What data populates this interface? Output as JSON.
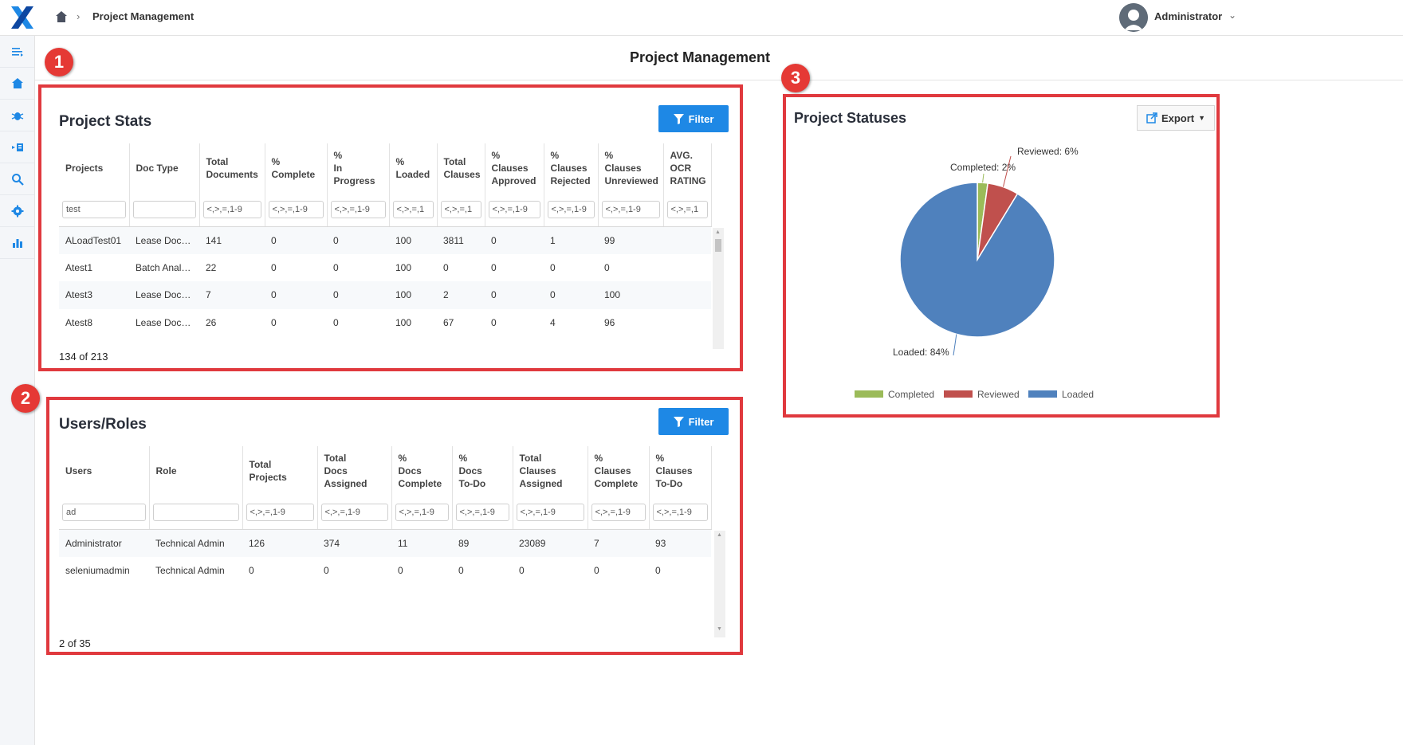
{
  "header": {
    "breadcrumb_title": "Project Management",
    "user_name": "Administrator"
  },
  "page": {
    "title": "Project Management"
  },
  "callouts": [
    "1",
    "2",
    "3"
  ],
  "project_stats": {
    "title": "Project Stats",
    "filter_label": "Filter",
    "columns": [
      [
        "Projects"
      ],
      [
        "Doc Type"
      ],
      [
        "Total",
        "Documents"
      ],
      [
        "%",
        "Complete"
      ],
      [
        "%",
        "In Progress"
      ],
      [
        "%",
        "Loaded"
      ],
      [
        "Total",
        "Clauses"
      ],
      [
        "%",
        "Clauses",
        "Approved"
      ],
      [
        "%",
        "Clauses",
        "Rejected"
      ],
      [
        "%",
        "Clauses",
        "Unreviewed"
      ],
      [
        "AVG.",
        "OCR",
        "RATING"
      ]
    ],
    "filters": [
      "test",
      "",
      "<,>,=,1-9",
      "<,>,=,1-9",
      "<,>,=,1-9",
      "<,>,=,1",
      "<,>,=,1",
      "<,>,=,1-9",
      "<,>,=,1-9",
      "<,>,=,1-9",
      "<,>,=,1"
    ],
    "rows": [
      [
        "ALoadTest01",
        "Lease Docu…",
        "141",
        "0",
        "0",
        "100",
        "3811",
        "0",
        "1",
        "99",
        ""
      ],
      [
        "Atest1",
        "Batch Anal…",
        "22",
        "0",
        "0",
        "100",
        "0",
        "0",
        "0",
        "0",
        ""
      ],
      [
        "Atest3",
        "Lease Docu…",
        "7",
        "0",
        "0",
        "100",
        "2",
        "0",
        "0",
        "100",
        ""
      ],
      [
        "Atest8",
        "Lease Docu…",
        "26",
        "0",
        "0",
        "100",
        "67",
        "0",
        "4",
        "96",
        ""
      ]
    ],
    "count_text": "134 of 213"
  },
  "users_roles": {
    "title": "Users/Roles",
    "filter_label": "Filter",
    "columns": [
      [
        "Users"
      ],
      [
        "Role"
      ],
      [
        "Total Projects"
      ],
      [
        "Total",
        "Docs",
        "Assigned"
      ],
      [
        "%",
        "Docs",
        "Complete"
      ],
      [
        "%",
        "Docs",
        "To-Do"
      ],
      [
        "Total",
        "Clauses",
        "Assigned"
      ],
      [
        "%",
        "Clauses",
        "Complete"
      ],
      [
        "%",
        "Clauses",
        "To-Do"
      ]
    ],
    "filters": [
      "ad",
      "",
      "<,>,=,1-9",
      "<,>,=,1-9",
      "<,>,=,1-9",
      "<,>,=,1-9",
      "<,>,=,1-9",
      "<,>,=,1-9",
      "<,>,=,1-9"
    ],
    "rows": [
      [
        "Administrator",
        "Technical Admin",
        "126",
        "374",
        "11",
        "89",
        "23089",
        "7",
        "93"
      ],
      [
        "seleniumadmin",
        "Technical Admin",
        "0",
        "0",
        "0",
        "0",
        "0",
        "0",
        "0"
      ]
    ],
    "count_text": "2 of 35"
  },
  "project_statuses": {
    "title": "Project Statuses",
    "export_label": "Export"
  },
  "chart_data": {
    "type": "pie",
    "title": "",
    "slices": [
      {
        "label": "Completed",
        "value": 2,
        "display": "Completed: 2%",
        "color": "#9bbb59"
      },
      {
        "label": "Reviewed",
        "value": 6,
        "display": "Reviewed: 6%",
        "color": "#c0504d"
      },
      {
        "label": "Loaded",
        "value": 84,
        "display": "Loaded: 84%",
        "color": "#4f81bd"
      }
    ],
    "legend_position": "bottom"
  },
  "icons": {
    "logo": "logo-x-icon",
    "home": "home-icon",
    "sidebar": [
      "menu-collapse-icon",
      "home-icon",
      "bug-icon",
      "import-icon",
      "search-icon",
      "gear-icon",
      "bar-chart-icon"
    ]
  }
}
